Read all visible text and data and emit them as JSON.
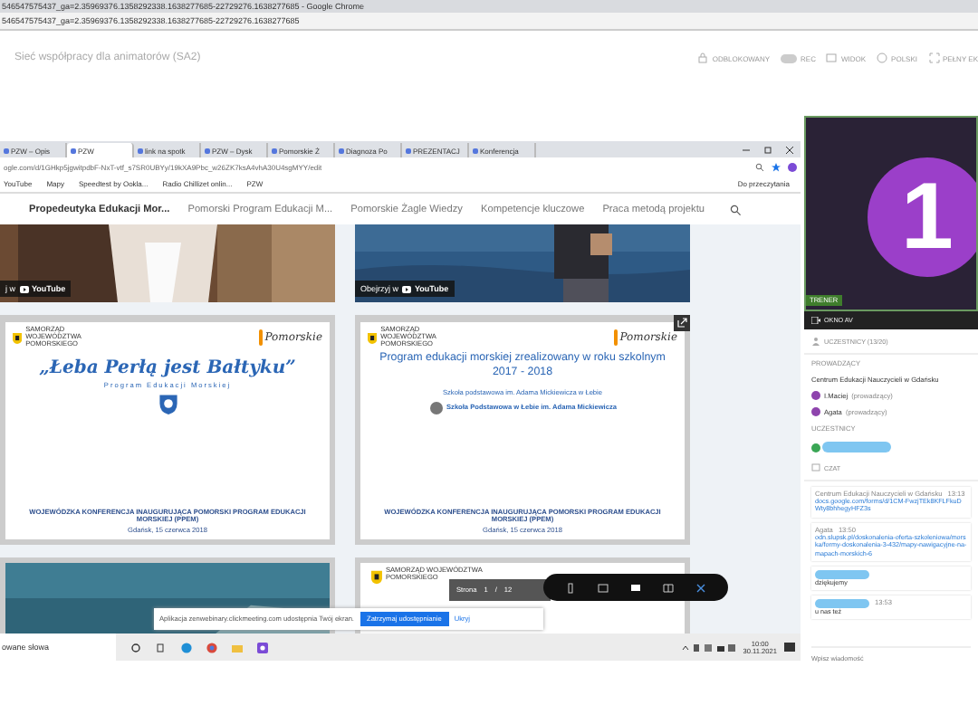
{
  "window": {
    "title": "546547575437_ga=2.35969376.1358292338.1638277685-22729276.1638277685 - Google Chrome",
    "url": "546547575437_ga=2.35969376.1358292338.1638277685-22729276.1638277685"
  },
  "header": {
    "title": "Sieć współpracy dla animatorów (SA2)",
    "controls": [
      {
        "kind": "lock",
        "label": "ODBLOKOWANY"
      },
      {
        "kind": "toggle",
        "label": "REC",
        "on": false
      },
      {
        "kind": "view",
        "label": "WIDOK"
      },
      {
        "kind": "language",
        "label": "POLSKI"
      },
      {
        "kind": "fullscreen",
        "label": "PEŁNY EK"
      }
    ]
  },
  "shared_screen": {
    "browser_tabs": [
      {
        "label": "PZW – Opis",
        "selected": false
      },
      {
        "label": "PZW",
        "selected": true
      },
      {
        "label": "link na spotk",
        "selected": false
      },
      {
        "label": "PZW – Dysk",
        "selected": false
      },
      {
        "label": "Pomorskie Ż",
        "selected": false
      },
      {
        "label": "Diagnoza Po",
        "selected": false
      },
      {
        "label": "PREZENTACJ",
        "selected": false
      },
      {
        "label": "Konferencja",
        "selected": false
      }
    ],
    "url": "ogle.com/d/1GHkp5jgwitpdbF-NxT-vtf_s7SR0UBYy/19kXA9Pbc_w26ZK7ksA4vhA30U4sgMYY/edit",
    "bookmarks": [
      "YouTube",
      "Mapy",
      "Speedtest by Ookla...",
      "Radio Chillizet onlin...",
      "PZW"
    ],
    "reading_list": "Do przeczytania",
    "site_nav": [
      {
        "label": "Propedeutyka Edukacji Mor...",
        "selected": true
      },
      {
        "label": "Pomorski Program Edukacji M...",
        "selected": false
      },
      {
        "label": "Pomorskie Żagle Wiedzy",
        "selected": false
      },
      {
        "label": "Kompetencje kluczowe",
        "selected": false
      },
      {
        "label": "Praca metodą projektu",
        "selected": false
      }
    ],
    "videos": [
      {
        "watch_label": "j w",
        "brand": "YouTube"
      },
      {
        "watch_label": "Obejrzyj w",
        "brand": "YouTube"
      }
    ],
    "slides": [
      {
        "kind": "title",
        "header": "SAMORZĄD WOJEWÓDZTWA POMORSKIEGO",
        "logo_text": "Pomorskie",
        "title": "„Łeba Perłą jest Bałtyku”",
        "subtitle": "Program Edukacji Morskiej",
        "footer": "WOJEWÓDZKA KONFERENCJA INAUGURUJĄCA POMORSKI PROGRAM EDUKACJI MORSKIEJ (PPEM)",
        "date": "Gdańsk, 15 czerwca 2018"
      },
      {
        "kind": "school",
        "header": "SAMORZĄD WOJEWÓDZTWA POMORSKIEGO",
        "logo_text": "Pomorskie",
        "title": "Program edukacji morskiej zrealizowany w roku szkolnym 2017 - 2018",
        "subtitle": "Szkoła podstawowa im. Adama Mickiewicza w Łebie",
        "badge": "Szkoła Podstawowa w Łebie im. Adama Mickiewicza",
        "footer": "WOJEWÓDZKA KONFERENCJA INAUGURUJĄCA POMORSKI PROGRAM EDUKACJI MORSKIEJ (PPEM)",
        "date": "Gdańsk, 15 czerwca 2018"
      }
    ],
    "lower_slide_header": "SAMORZĄD WOJEWÓDZTWA POMORSKIEGO",
    "pdf_toolbar": {
      "page_label": "Strona",
      "page": "1",
      "separator": "/",
      "total": "12"
    },
    "share_bar": {
      "message": "Aplikacja zenwebinary.clickmeeting.com udostępnia Twój ekran.",
      "stop_button": "Zatrzymaj udostępnianie",
      "hide_link": "Ukryj"
    },
    "taskbar": {
      "search": "owane słowa",
      "time": "10:00",
      "date": "30.11.2021"
    }
  },
  "side_panel": {
    "video": {
      "number": "1",
      "label": "TRENER"
    },
    "av_window": "OKNO AV",
    "participants": {
      "title": "UCZESTNICY (13/20)",
      "hosts_label": "PROWADZĄCY",
      "organization": "Centrum Edukacji Nauczycieli w Gdańsku",
      "hosts": [
        {
          "name": "I.Maciej",
          "role": "(prowadzący)"
        },
        {
          "name": "Agata",
          "role": "(prowadzący)"
        }
      ],
      "attendees_label": "UCZESTNICY"
    },
    "chat": {
      "title": "CZAT",
      "messages": [
        {
          "kind": "named",
          "author": "Centrum Edukacji Nauczycieli w Gdańsku",
          "time": "13:13",
          "text": "docs.google.com/forms/d/1CM-FwzjTEk8KFLFkuDWty8bhhegyHFZ3s"
        },
        {
          "kind": "named",
          "author": "Agata",
          "time": "13:50",
          "text": "odn.slupsk.pl/doskonalenia-oferta-szkoleniowa/morska/formy-doskonalenia-3-432/mapy-nawigacyjne-na-mapach-morskich-6"
        },
        {
          "kind": "hidden",
          "text": "dziękujemy"
        },
        {
          "kind": "hidden",
          "time": "13:53",
          "text": "u nas też"
        }
      ],
      "placeholder": "Wpisz wiadomość"
    }
  }
}
